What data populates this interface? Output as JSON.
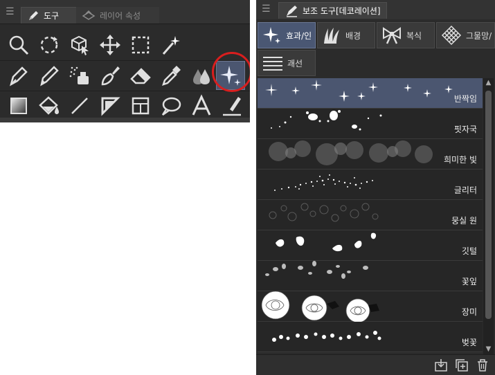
{
  "tool_panel": {
    "menu_icon": "hamburger-icon",
    "tabs": [
      {
        "label": "도구",
        "icon": "pen-icon",
        "active": true
      },
      {
        "label": "레이어 속성",
        "icon": "layer-property-icon",
        "active": false
      }
    ],
    "rows": [
      [
        {
          "name": "zoom-tool",
          "icon": "magnifier-icon"
        },
        {
          "name": "rotate-view-tool",
          "icon": "rotate-icon"
        },
        {
          "name": "object-tool",
          "icon": "object-cursor-icon"
        },
        {
          "name": "move-layer-tool",
          "icon": "move-arrows-icon"
        },
        {
          "name": "selection-tool",
          "icon": "marquee-icon"
        },
        {
          "name": "auto-select-tool",
          "icon": "magic-wand-icon"
        }
      ],
      [
        {
          "name": "pen-tool",
          "icon": "pen-nib-icon"
        },
        {
          "name": "pencil-tool",
          "icon": "pencil-icon"
        },
        {
          "name": "airbrush-tool",
          "icon": "airbrush-icon"
        },
        {
          "name": "brush-tool",
          "icon": "brush-icon"
        },
        {
          "name": "eraser-tool",
          "icon": "eraser-icon"
        },
        {
          "name": "eyedropper-tool",
          "icon": "eyedropper-icon"
        },
        {
          "name": "blend-tool",
          "icon": "blend-drops-icon"
        },
        {
          "name": "decoration-tool",
          "icon": "sparkle-icon",
          "selected": true
        }
      ],
      [
        {
          "name": "gradient-tool",
          "icon": "gradient-icon"
        },
        {
          "name": "fill-tool",
          "icon": "paint-bucket-icon"
        },
        {
          "name": "figure-tool",
          "icon": "line-icon"
        },
        {
          "name": "ruler-tool",
          "icon": "ruler-icon"
        },
        {
          "name": "frame-border-tool",
          "icon": "frame-icon"
        },
        {
          "name": "balloon-tool",
          "icon": "speech-balloon-icon"
        },
        {
          "name": "text-tool",
          "icon": "text-icon"
        },
        {
          "name": "correct-line-tool",
          "icon": "correct-line-icon"
        }
      ]
    ]
  },
  "sub_tool_panel": {
    "menu_icon": "hamburger-icon",
    "tab_label": "보조 도구[데코레이션]",
    "tab_icon": "decoration-brush-icon",
    "groups": [
      {
        "label": "효과/인",
        "icon": "sparkle-icon",
        "active": true
      },
      {
        "label": "배경",
        "icon": "grass-icon",
        "active": false
      },
      {
        "label": "복식",
        "icon": "ribbon-icon",
        "active": false
      },
      {
        "label": "그물망/",
        "icon": "net-pattern-icon",
        "active": false
      },
      {
        "label": "괘선",
        "icon": "ruled-lines-icon",
        "active": false
      }
    ],
    "items": [
      {
        "label": "반짝임",
        "preview": "sparkles",
        "selected": true
      },
      {
        "label": "핏자국",
        "preview": "blood-splatter"
      },
      {
        "label": "희미한 빛",
        "preview": "faint-light"
      },
      {
        "label": "글리터",
        "preview": "glitter"
      },
      {
        "label": "뭉실 원",
        "preview": "soft-circles"
      },
      {
        "label": "깃털",
        "preview": "feathers"
      },
      {
        "label": "꽃잎",
        "preview": "petals"
      },
      {
        "label": "장미",
        "preview": "roses"
      },
      {
        "label": "벚꽃",
        "preview": "cherry-blossoms"
      }
    ],
    "footer_buttons": [
      {
        "name": "import-subtool-button",
        "icon": "import-icon"
      },
      {
        "name": "create-subtool-button",
        "icon": "add-copy-icon"
      },
      {
        "name": "delete-subtool-button",
        "icon": "trash-icon"
      }
    ]
  },
  "colors": {
    "panel_bg": "#2b2b2b",
    "selected_bg": "#4b5670",
    "highlight_ring": "#d91e1e",
    "text": "#e6e6e6"
  }
}
